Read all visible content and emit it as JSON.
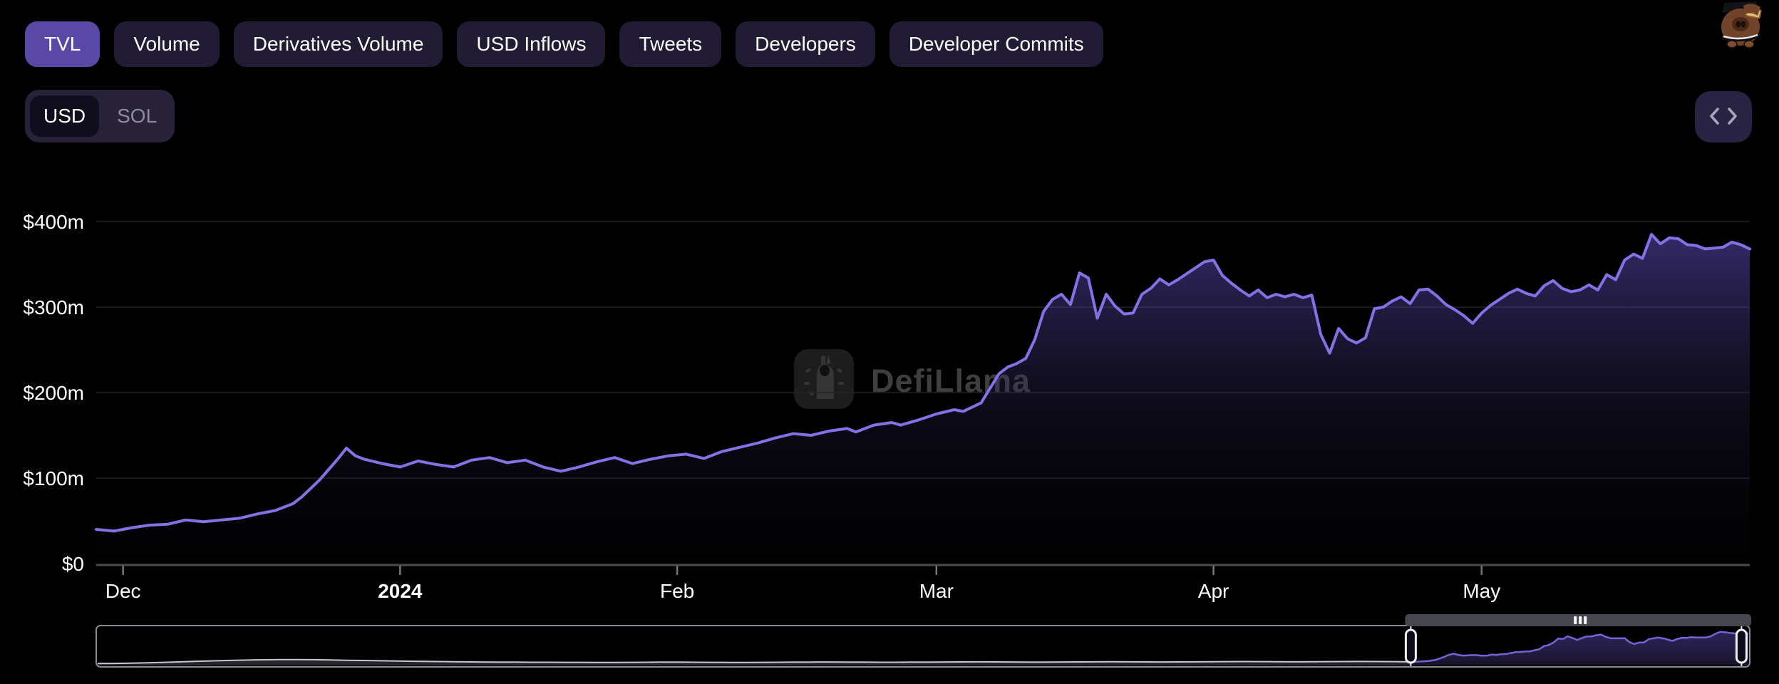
{
  "header": {
    "tabs": [
      {
        "label": "TVL",
        "active": true
      },
      {
        "label": "Volume",
        "active": false
      },
      {
        "label": "Derivatives Volume",
        "active": false
      },
      {
        "label": "USD Inflows",
        "active": false
      },
      {
        "label": "Tweets",
        "active": false
      },
      {
        "label": "Developers",
        "active": false
      },
      {
        "label": "Developer Commits",
        "active": false
      }
    ],
    "currency_toggle": {
      "options": [
        "USD",
        "SOL"
      ],
      "selected": "USD"
    },
    "embed_button_icon": "code-icon",
    "avatar_icon": "llama-mascot"
  },
  "watermark": {
    "text": "DefiLlama",
    "icon": "defillama-logo-icon"
  },
  "colors": {
    "page_bg": "#000000",
    "accent_active_tab": "#5948a5",
    "tab_bg": "#211c33",
    "line": "#8471e6",
    "area_top": "#6a57d6",
    "grid": "#232323",
    "axis_line": "#4b4b4b",
    "brush_border": "#8b8b95",
    "brush_gray_line": "#c6c6d4",
    "brush_gray_fill": "#242429",
    "brush_purple_line": "#7763d6",
    "brush_bar": "#474750",
    "watermark_text": "#3e3e3e"
  },
  "chart_data": {
    "type": "area",
    "title": "TVL (USD)",
    "unit": "USD millions",
    "start_date": "2023-11-28",
    "end_date": "2024-05-31",
    "total_days": 185,
    "ylim": [
      0,
      400
    ],
    "grid": "horizontal-only",
    "y_ticks": [
      {
        "label": "$0",
        "value": 0
      },
      {
        "label": "$100m",
        "value": 100
      },
      {
        "label": "$200m",
        "value": 200
      },
      {
        "label": "$300m",
        "value": 300
      },
      {
        "label": "$400m",
        "value": 400
      }
    ],
    "x_ticks": [
      {
        "label": "Dec",
        "day": 3,
        "bold": false
      },
      {
        "label": "2024",
        "day": 34,
        "bold": true
      },
      {
        "label": "Feb",
        "day": 65,
        "bold": false
      },
      {
        "label": "Mar",
        "day": 94,
        "bold": false
      },
      {
        "label": "Apr",
        "day": 125,
        "bold": false
      },
      {
        "label": "May",
        "day": 155,
        "bold": false
      }
    ],
    "series": [
      {
        "name": "TVL",
        "color": "#8471e6",
        "points": [
          [
            0,
            40
          ],
          [
            2,
            38
          ],
          [
            4,
            42
          ],
          [
            6,
            45
          ],
          [
            8,
            46
          ],
          [
            10,
            51
          ],
          [
            12,
            49
          ],
          [
            14,
            51
          ],
          [
            16,
            53
          ],
          [
            18,
            58
          ],
          [
            20,
            62
          ],
          [
            22,
            70
          ],
          [
            23,
            78
          ],
          [
            24,
            88
          ],
          [
            25,
            98
          ],
          [
            26,
            110
          ],
          [
            27,
            122
          ],
          [
            28,
            135
          ],
          [
            29,
            126
          ],
          [
            30,
            122
          ],
          [
            32,
            117
          ],
          [
            34,
            113
          ],
          [
            36,
            120
          ],
          [
            38,
            116
          ],
          [
            40,
            113
          ],
          [
            42,
            121
          ],
          [
            44,
            124
          ],
          [
            46,
            118
          ],
          [
            48,
            121
          ],
          [
            50,
            113
          ],
          [
            52,
            108
          ],
          [
            54,
            113
          ],
          [
            56,
            119
          ],
          [
            58,
            124
          ],
          [
            60,
            117
          ],
          [
            62,
            122
          ],
          [
            64,
            126
          ],
          [
            66,
            128
          ],
          [
            68,
            123
          ],
          [
            70,
            131
          ],
          [
            72,
            136
          ],
          [
            74,
            141
          ],
          [
            76,
            147
          ],
          [
            78,
            152
          ],
          [
            80,
            150
          ],
          [
            82,
            155
          ],
          [
            84,
            158
          ],
          [
            85,
            154
          ],
          [
            87,
            162
          ],
          [
            89,
            165
          ],
          [
            90,
            162
          ],
          [
            92,
            168
          ],
          [
            94,
            175
          ],
          [
            96,
            180
          ],
          [
            97,
            178
          ],
          [
            99,
            188
          ],
          [
            100,
            205
          ],
          [
            101,
            222
          ],
          [
            102,
            230
          ],
          [
            103,
            234
          ],
          [
            104,
            240
          ],
          [
            105,
            262
          ],
          [
            106,
            295
          ],
          [
            107,
            309
          ],
          [
            108,
            315
          ],
          [
            109,
            303
          ],
          [
            110,
            340
          ],
          [
            111,
            334
          ],
          [
            112,
            287
          ],
          [
            113,
            315
          ],
          [
            114,
            301
          ],
          [
            115,
            292
          ],
          [
            116,
            293
          ],
          [
            117,
            315
          ],
          [
            118,
            322
          ],
          [
            119,
            333
          ],
          [
            120,
            326
          ],
          [
            121,
            332
          ],
          [
            122,
            339
          ],
          [
            123,
            346
          ],
          [
            124,
            353
          ],
          [
            125,
            355
          ],
          [
            126,
            337
          ],
          [
            127,
            328
          ],
          [
            128,
            320
          ],
          [
            129,
            313
          ],
          [
            130,
            320
          ],
          [
            131,
            311
          ],
          [
            132,
            315
          ],
          [
            133,
            312
          ],
          [
            134,
            315
          ],
          [
            135,
            311
          ],
          [
            136,
            314
          ],
          [
            137,
            268
          ],
          [
            138,
            246
          ],
          [
            139,
            275
          ],
          [
            140,
            263
          ],
          [
            141,
            258
          ],
          [
            142,
            264
          ],
          [
            143,
            298
          ],
          [
            144,
            300
          ],
          [
            145,
            307
          ],
          [
            146,
            312
          ],
          [
            147,
            304
          ],
          [
            148,
            320
          ],
          [
            149,
            321
          ],
          [
            150,
            313
          ],
          [
            151,
            303
          ],
          [
            152,
            297
          ],
          [
            153,
            290
          ],
          [
            154,
            281
          ],
          [
            155,
            293
          ],
          [
            156,
            302
          ],
          [
            157,
            309
          ],
          [
            158,
            316
          ],
          [
            159,
            321
          ],
          [
            160,
            316
          ],
          [
            161,
            313
          ],
          [
            162,
            325
          ],
          [
            163,
            331
          ],
          [
            164,
            322
          ],
          [
            165,
            318
          ],
          [
            166,
            320
          ],
          [
            167,
            326
          ],
          [
            168,
            320
          ],
          [
            169,
            338
          ],
          [
            170,
            332
          ],
          [
            171,
            355
          ],
          [
            172,
            362
          ],
          [
            173,
            357
          ],
          [
            174,
            385
          ],
          [
            175,
            374
          ],
          [
            176,
            381
          ],
          [
            177,
            380
          ],
          [
            178,
            373
          ],
          [
            179,
            372
          ],
          [
            180,
            368
          ],
          [
            181,
            369
          ],
          [
            182,
            370
          ],
          [
            183,
            376
          ],
          [
            184,
            373
          ],
          [
            185,
            368
          ]
        ]
      }
    ]
  },
  "brush": {
    "selection": {
      "start_frac": 0.795,
      "end_frac": 0.995
    },
    "grip_icon": "drag-grip-icon",
    "scale_max": 392,
    "prefix_series": [
      22,
      24,
      27,
      31,
      36,
      42,
      48,
      53,
      58,
      62,
      65,
      67,
      68,
      66,
      63,
      60,
      57,
      54,
      51,
      48,
      46,
      44,
      42,
      40,
      39,
      38,
      37,
      37,
      36,
      36,
      35,
      35,
      36,
      37,
      38,
      38,
      37,
      36,
      35,
      35,
      36,
      37,
      38,
      39,
      40,
      39,
      38,
      37,
      37,
      38,
      39,
      40,
      41,
      42,
      41,
      40,
      39,
      39,
      40,
      41,
      42,
      43,
      42,
      41,
      40,
      41,
      42,
      43,
      44,
      45,
      44,
      43,
      42,
      43,
      44,
      45,
      46,
      45,
      44,
      42
    ],
    "selected_series": [
      40,
      42,
      46,
      49,
      53,
      62,
      78,
      98,
      122,
      135,
      122,
      113,
      116,
      121,
      118,
      113,
      113,
      124,
      122,
      128,
      131,
      141,
      152,
      155,
      160,
      162,
      175,
      185,
      222,
      234,
      262,
      309,
      303,
      334,
      315,
      292,
      315,
      333,
      332,
      346,
      355,
      328,
      313,
      311,
      312,
      311,
      268,
      246,
      263,
      264,
      300,
      312,
      320,
      313,
      297,
      281,
      302,
      316,
      316,
      325,
      322,
      320,
      320,
      332,
      362,
      385,
      381,
      373,
      368,
      370,
      373,
      368
    ]
  }
}
